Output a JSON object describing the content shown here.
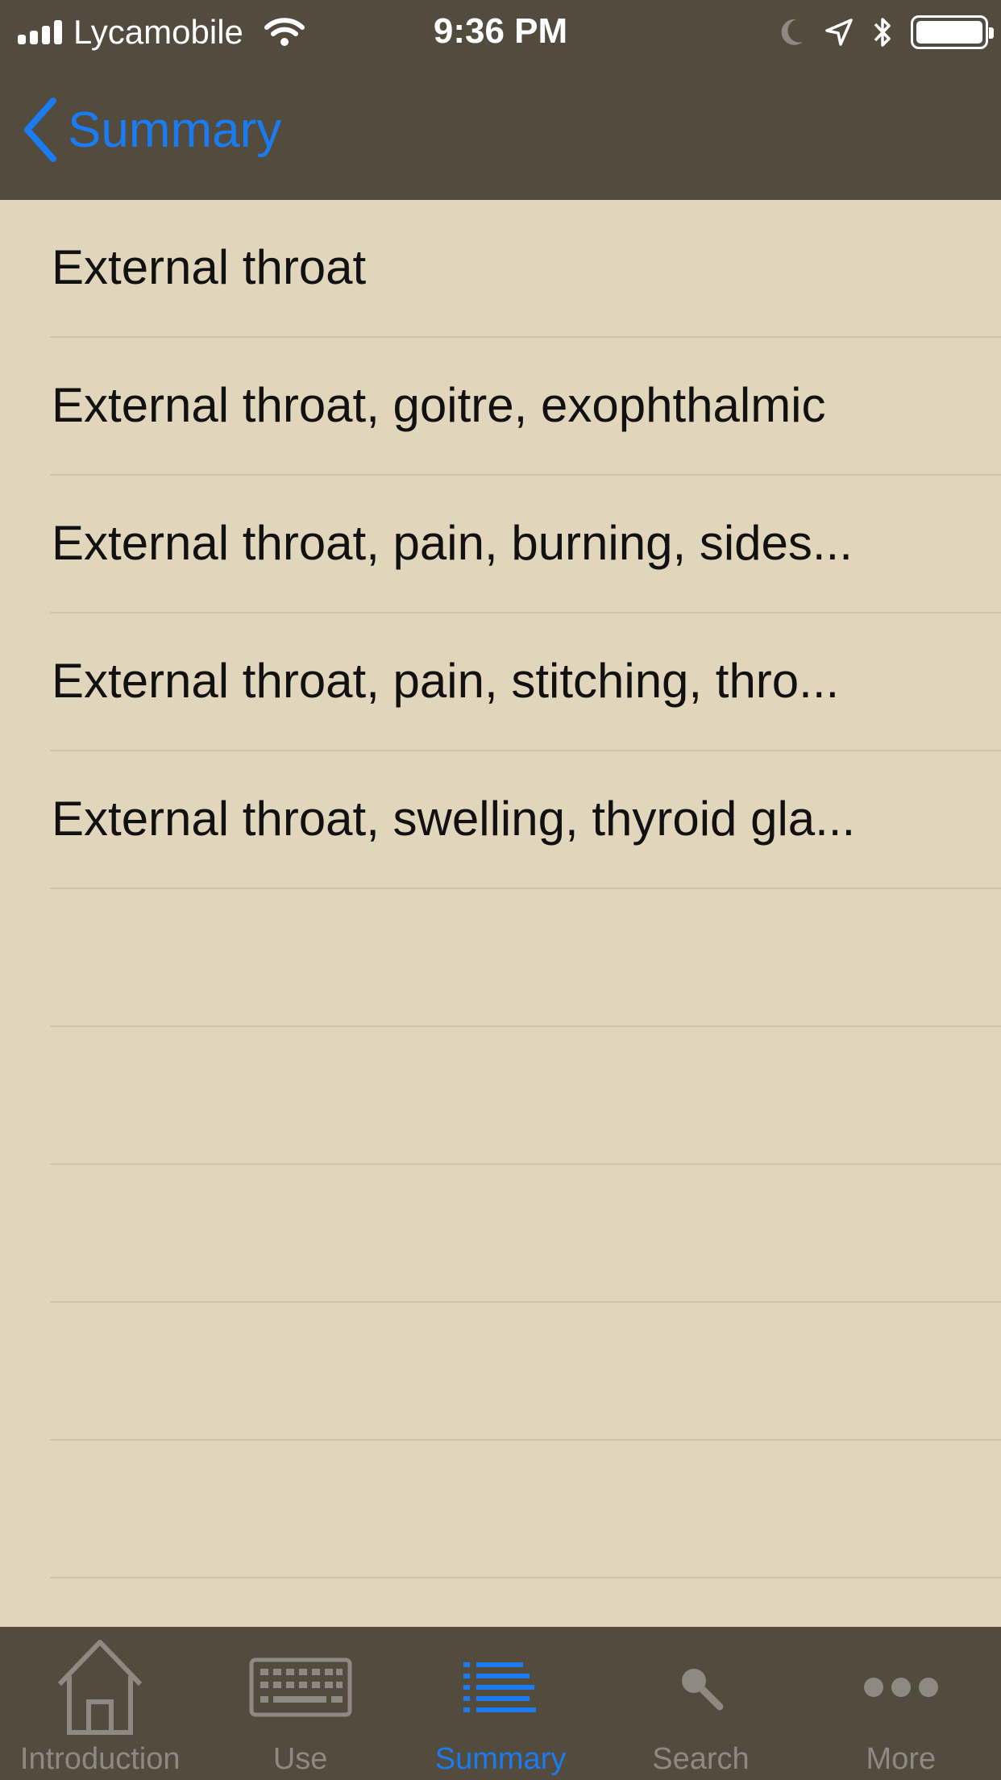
{
  "status_bar": {
    "carrier": "Lycamobile",
    "time": "9:36 PM",
    "icons": [
      "signal-icon",
      "wifi-icon",
      "moon-icon",
      "location-icon",
      "bluetooth-icon",
      "battery-icon"
    ]
  },
  "nav": {
    "back_label": "Summary"
  },
  "list": {
    "items": [
      {
        "label": "External throat"
      },
      {
        "label": "External throat, goitre, exophthalmic"
      },
      {
        "label": "External throat, pain, burning, sides..."
      },
      {
        "label": "External throat, pain, stitching, thro..."
      },
      {
        "label": "External throat, swelling, thyroid gla..."
      }
    ]
  },
  "tab_bar": {
    "tabs": [
      {
        "label": "Introduction",
        "icon": "house-icon",
        "active": false
      },
      {
        "label": "Use",
        "icon": "keyboard-icon",
        "active": false
      },
      {
        "label": "Summary",
        "icon": "list-icon",
        "active": true
      },
      {
        "label": "Search",
        "icon": "magnifier-icon",
        "active": false
      },
      {
        "label": "More",
        "icon": "more-dots-icon",
        "active": false
      }
    ]
  },
  "colors": {
    "bar_background": "#524b3e",
    "content_background": "#e1d5bb",
    "accent": "#1a7cf0",
    "inactive_tab": "#8e8a82"
  }
}
